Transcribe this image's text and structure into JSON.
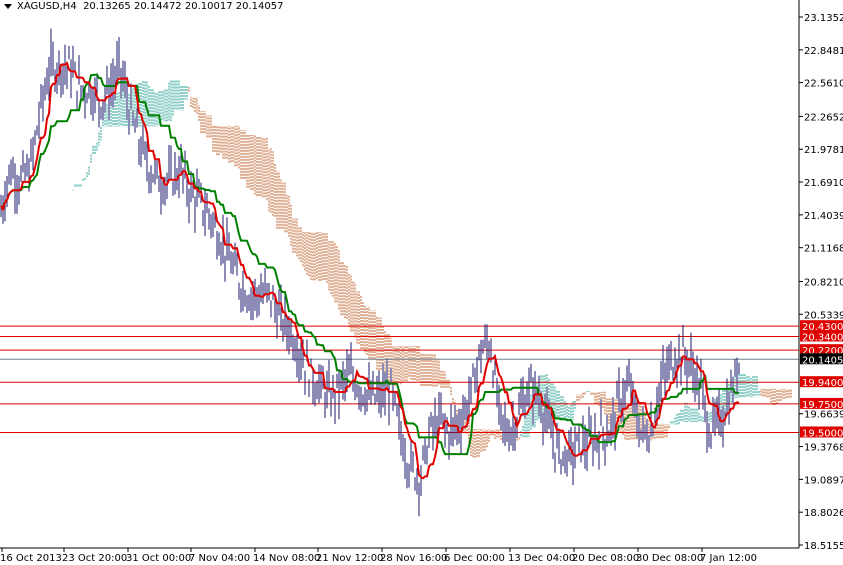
{
  "header": {
    "symbol": "XAGUSD,H4",
    "ohlc": "20.13265 20.14472 20.10017 20.14057"
  },
  "chart_data": {
    "type": "ohlc",
    "title": "XAGUSD,H4",
    "indicator": "Ichimoku Kinko Hyo",
    "ylim": [
      18.5155,
      23.1352
    ],
    "y_ticks": [
      "23.13520",
      "22.84810",
      "22.56100",
      "22.26520",
      "21.97810",
      "21.69100",
      "21.40390",
      "21.11680",
      "20.82100",
      "20.53390",
      "19.66390",
      "19.37680",
      "19.08970",
      "18.80260",
      "18.51550"
    ],
    "y_tick_values": [
      23.1352,
      22.8481,
      22.561,
      22.2652,
      21.9781,
      21.691,
      21.4039,
      21.1168,
      20.821,
      20.5339,
      19.6639,
      19.3768,
      19.0897,
      18.8026,
      18.5155
    ],
    "x_labels": [
      "16 Oct 2013",
      "23 Oct 20:00",
      "31 Oct 00:00",
      "7 Nov 04:00",
      "14 Nov 08:00",
      "21 Nov 12:00",
      "28 Nov 16:00",
      "6 Dec 00:00",
      "13 Dec 04:00",
      "20 Dec 08:00",
      "30 Dec 08:00",
      "7 Jan 12:00"
    ],
    "closes_sampled": [
      21.4,
      21.8,
      21.7,
      21.8,
      22.3,
      22.7,
      22.7,
      22.7,
      22.5,
      22.5,
      22.4,
      22.5,
      22.7,
      22.3,
      22.0,
      21.8,
      21.7,
      21.7,
      21.8,
      21.6,
      21.5,
      21.4,
      21.2,
      21.0,
      20.8,
      20.7,
      20.7,
      20.7,
      20.5,
      20.4,
      20.2,
      20.0,
      19.9,
      19.8,
      19.9,
      20.0,
      19.9,
      19.8,
      19.8,
      19.9,
      19.5,
      19.2,
      19.1,
      19.5,
      19.6,
      19.5,
      19.6,
      19.8,
      20.2,
      20.3,
      19.6,
      19.5,
      19.7,
      19.9,
      19.8,
      19.5,
      19.3,
      19.3,
      19.4,
      19.4,
      19.5,
      19.5,
      19.8,
      19.9,
      19.5,
      19.5,
      19.9,
      20.1,
      20.2,
      20.1,
      19.9,
      19.5,
      19.6,
      19.8,
      20.14057
    ],
    "levels": [
      {
        "label": "20.43000",
        "value": 20.43,
        "color": "#e00000"
      },
      {
        "label": "20.34000",
        "value": 20.34,
        "color": "#e00000"
      },
      {
        "label": "20.22000",
        "value": 20.22,
        "color": "#e00000"
      },
      {
        "label": "19.94000",
        "value": 19.94,
        "color": "#e00000"
      },
      {
        "label": "19.75000",
        "value": 19.75,
        "color": "#e00000"
      },
      {
        "label": "19.50000",
        "value": 19.5,
        "color": "#e00000"
      }
    ],
    "current_price": {
      "label": "20.14057",
      "value": 20.14057,
      "color": "#000000"
    },
    "colors": {
      "bars": "#1a1a6e",
      "tenkan": "#e00000",
      "kijun": "#008000",
      "cloud_up": "#20a090",
      "cloud_down": "#c0602a"
    }
  }
}
